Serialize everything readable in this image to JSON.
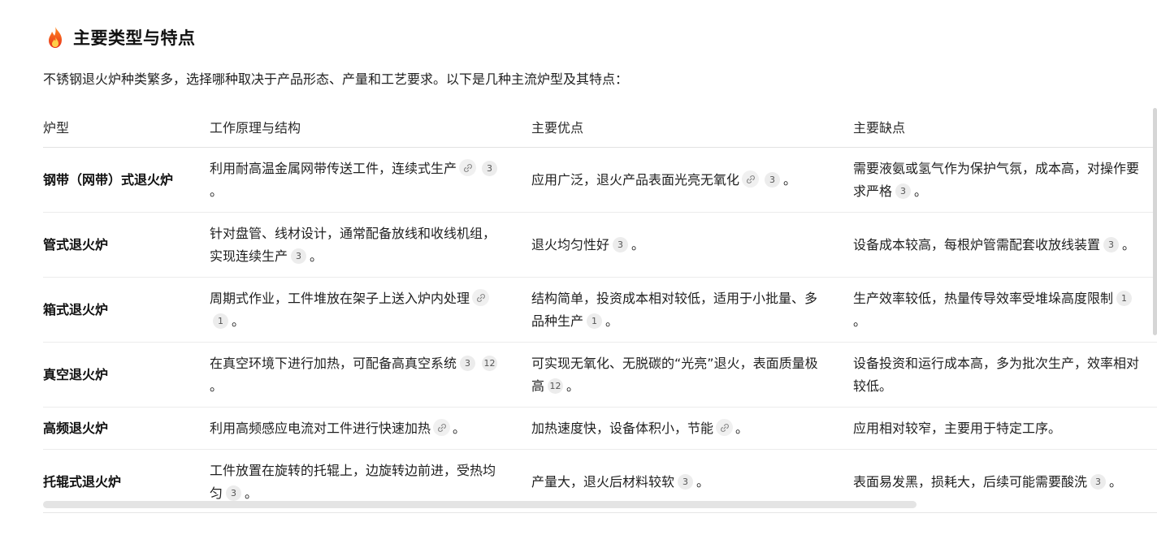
{
  "section": {
    "icon": "fire-icon",
    "title": "主要类型与特点",
    "intro": "不锈钢退火炉种类繁多，选择哪种取决于产品形态、产量和工艺要求。以下是几种主流炉型及其特点："
  },
  "table": {
    "headers": [
      "炉型",
      "工作原理与结构",
      "主要优点",
      "主要缺点"
    ],
    "rows": [
      {
        "type": "钢带（网带）式退火炉",
        "principle": {
          "text": "利用耐高温金属网带传送工件，连续式生产",
          "link": true,
          "cites": [
            "3"
          ],
          "tail": "。"
        },
        "pros": {
          "text": "应用广泛，退火产品表面光亮无氧化",
          "link": true,
          "cites": [
            "3"
          ],
          "tail": "。"
        },
        "cons": {
          "text": "需要液氨或氢气作为保护气氛，成本高，对操作要求严格",
          "link": false,
          "cites": [
            "3"
          ],
          "tail": "。"
        }
      },
      {
        "type": "管式退火炉",
        "principle": {
          "text": "针对盘管、线材设计，通常配备放线和收线机组，实现连续生产",
          "link": false,
          "cites": [
            "3"
          ],
          "tail": "。"
        },
        "pros": {
          "text": "退火均匀性好",
          "link": false,
          "cites": [
            "3"
          ],
          "tail": "。"
        },
        "cons": {
          "text": "设备成本较高，每根炉管需配套收放线装置",
          "link": false,
          "cites": [
            "3"
          ],
          "tail": "。"
        }
      },
      {
        "type": "箱式退火炉",
        "principle": {
          "text": "周期式作业，工件堆放在架子上送入炉内处理",
          "link": true,
          "cites": [
            "1"
          ],
          "tail": "。"
        },
        "pros": {
          "text": "结构简单，投资成本相对较低，适用于小批量、多品种生产",
          "link": false,
          "cites": [
            "1"
          ],
          "tail": "。"
        },
        "cons": {
          "text": "生产效率较低，热量传导效率受堆垛高度限制",
          "link": false,
          "cites": [
            "1"
          ],
          "tail": "。"
        }
      },
      {
        "type": "真空退火炉",
        "principle": {
          "text": "在真空环境下进行加热，可配备高真空系统",
          "link": false,
          "cites": [
            "3",
            "12"
          ],
          "tail": "。"
        },
        "pros": {
          "text": "可实现无氧化、无脱碳的“光亮”退火，表面质量极高",
          "link": false,
          "cites": [
            "12"
          ],
          "tail": "。"
        },
        "cons": {
          "text": "设备投资和运行成本高，多为批次生产，效率相对较低。",
          "link": false,
          "cites": [],
          "tail": ""
        }
      },
      {
        "type": "高频退火炉",
        "principle": {
          "text": "利用高频感应电流对工件进行快速加热",
          "link": true,
          "cites": [],
          "tail": "。"
        },
        "pros": {
          "text": "加热速度快，设备体积小，节能",
          "link": true,
          "cites": [],
          "tail": "。"
        },
        "cons": {
          "text": "应用相对较窄，主要用于特定工序。",
          "link": false,
          "cites": [],
          "tail": ""
        }
      },
      {
        "type": "托辊式退火炉",
        "principle": {
          "text": "工件放置在旋转的托辊上，边旋转边前进，受热均匀",
          "link": false,
          "cites": [
            "3"
          ],
          "tail": "。"
        },
        "pros": {
          "text": "产量大，退火后材料较软",
          "link": false,
          "cites": [
            "3"
          ],
          "tail": "。"
        },
        "cons": {
          "text": "表面易发黑，损耗大，后续可能需要酸洗",
          "link": false,
          "cites": [
            "3"
          ],
          "tail": "。"
        }
      }
    ]
  }
}
